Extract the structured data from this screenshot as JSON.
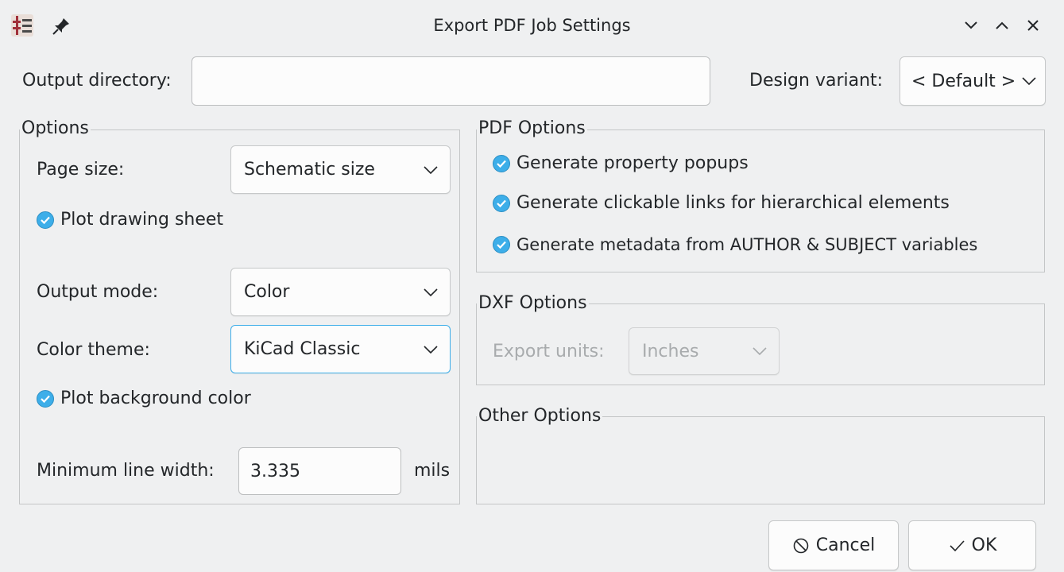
{
  "window": {
    "title": "Export PDF Job Settings"
  },
  "top": {
    "output_dir_label": "Output directory:",
    "output_dir_value": "",
    "design_variant_label": "Design variant:",
    "design_variant_value": "< Default >"
  },
  "options": {
    "title": "Options",
    "page_size_label": "Page size:",
    "page_size_value": "Schematic size",
    "plot_drawing_sheet": "Plot drawing sheet",
    "output_mode_label": "Output mode:",
    "output_mode_value": "Color",
    "color_theme_label": "Color theme:",
    "color_theme_value": "KiCad Classic",
    "plot_background": "Plot background color",
    "min_line_width_label": "Minimum line width:",
    "min_line_width_value": "3.335",
    "min_line_width_unit": "mils"
  },
  "pdf_options": {
    "title": "PDF Options",
    "popups": "Generate property popups",
    "links": "Generate clickable links for hierarchical elements",
    "metadata": "Generate metadata from AUTHOR & SUBJECT variables"
  },
  "dxf_options": {
    "title": "DXF Options",
    "export_units_label": "Export units:",
    "export_units_value": "Inches"
  },
  "other_options": {
    "title": "Other Options"
  },
  "buttons": {
    "cancel": "Cancel",
    "ok": "OK"
  },
  "colors": {
    "accent": "#3daee9",
    "background": "#eff0f1"
  }
}
